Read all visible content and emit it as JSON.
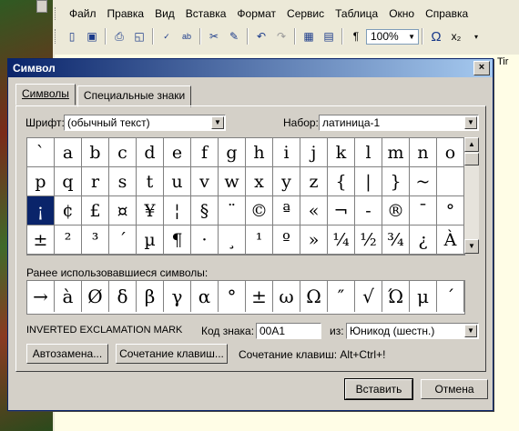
{
  "app": {
    "menu": [
      "Файл",
      "Правка",
      "Вид",
      "Вставка",
      "Формат",
      "Сервис",
      "Таблица",
      "Окно",
      "Справка"
    ],
    "zoom": "100%",
    "right_edge_text": "Tir"
  },
  "dialog": {
    "title": "Символ",
    "close": "×",
    "tabs": [
      "Символы",
      "Специальные знаки"
    ],
    "font_label": "Шрифт:",
    "font_value": "(обычный текст)",
    "subset_label": "Набор:",
    "subset_value": "латиница-1",
    "symbols": [
      [
        "`",
        "a",
        "b",
        "c",
        "d",
        "e",
        "f",
        "g",
        "h",
        "i",
        "j",
        "k",
        "l",
        "m",
        "n",
        "o"
      ],
      [
        "p",
        "q",
        "r",
        "s",
        "t",
        "u",
        "v",
        "w",
        "x",
        "y",
        "z",
        "{",
        "|",
        "}",
        "~",
        ""
      ],
      [
        "¡",
        "¢",
        "£",
        "¤",
        "¥",
        "¦",
        "§",
        "¨",
        "©",
        "ª",
        "«",
        "¬",
        "-",
        "®",
        "¯",
        "°"
      ],
      [
        "±",
        "²",
        "³",
        "´",
        "µ",
        "¶",
        "·",
        "¸",
        "¹",
        "º",
        "»",
        "¼",
        "½",
        "¾",
        "¿",
        "À"
      ]
    ],
    "recent_label": "Ранее использовавшиеся символы:",
    "recent": [
      "→",
      "à",
      "Ø",
      "δ",
      "β",
      "γ",
      "α",
      "°",
      "±",
      "ω",
      "Ω",
      "″",
      "√",
      "Ώ",
      "μ",
      "΄"
    ],
    "char_name": "INVERTED EXCLAMATION MARK",
    "code_label": "Код знака:",
    "code_value": "00A1",
    "from_label": "из:",
    "from_value": "Юникод (шестн.)",
    "autocorrect_btn": "Автозамена...",
    "shortcut_btn": "Сочетание клавиш...",
    "shortcut_text": "Сочетание клавиш: Alt+Ctrl+!",
    "insert_btn": "Вставить",
    "cancel_btn": "Отмена"
  }
}
